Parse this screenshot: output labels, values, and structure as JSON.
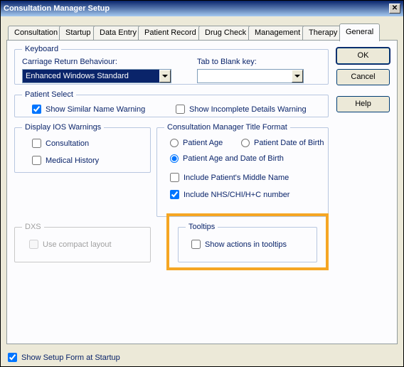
{
  "window": {
    "title": "Consultation Manager Setup"
  },
  "tabs": [
    "Consultation",
    "Startup",
    "Data Entry",
    "Patient Record",
    "Drug Check",
    "Management",
    "Therapy",
    "General"
  ],
  "active_tab_index": 7,
  "buttons": {
    "ok": "OK",
    "cancel": "Cancel",
    "help": "Help"
  },
  "keyboard": {
    "legend": "Keyboard",
    "carriage_label": "Carriage Return Behaviour:",
    "carriage_value": "Enhanced Windows Standard",
    "tab_blank_label": "Tab to Blank key:",
    "tab_blank_value": ""
  },
  "patient_select": {
    "legend": "Patient Select",
    "similar": {
      "label": "Show Similar Name Warning",
      "checked": true
    },
    "incomplete": {
      "label": "Show Incomplete Details Warning",
      "checked": false
    }
  },
  "ios": {
    "legend": "Display IOS Warnings",
    "consultation": {
      "label": "Consultation",
      "checked": false
    },
    "medical": {
      "label": "Medical History",
      "checked": false
    }
  },
  "title_format": {
    "legend": "Consultation Manager Title Format",
    "opt_age": "Patient Age",
    "opt_dob": "Patient Date of Birth",
    "opt_both": "Patient Age and Date of Birth",
    "selected": "both",
    "middle": {
      "label": "Include Patient's Middle Name",
      "checked": false
    },
    "nhs": {
      "label": "Include NHS/CHI/H+C number",
      "checked": true
    }
  },
  "dxs": {
    "legend": "DXS",
    "compact": {
      "label": "Use compact layout",
      "checked": false,
      "disabled": true
    }
  },
  "tooltips": {
    "legend": "Tooltips",
    "show_actions": {
      "label": "Show actions in tooltips",
      "checked": false
    }
  },
  "footer": {
    "show_setup": {
      "label": "Show Setup Form at Startup",
      "checked": true
    }
  }
}
